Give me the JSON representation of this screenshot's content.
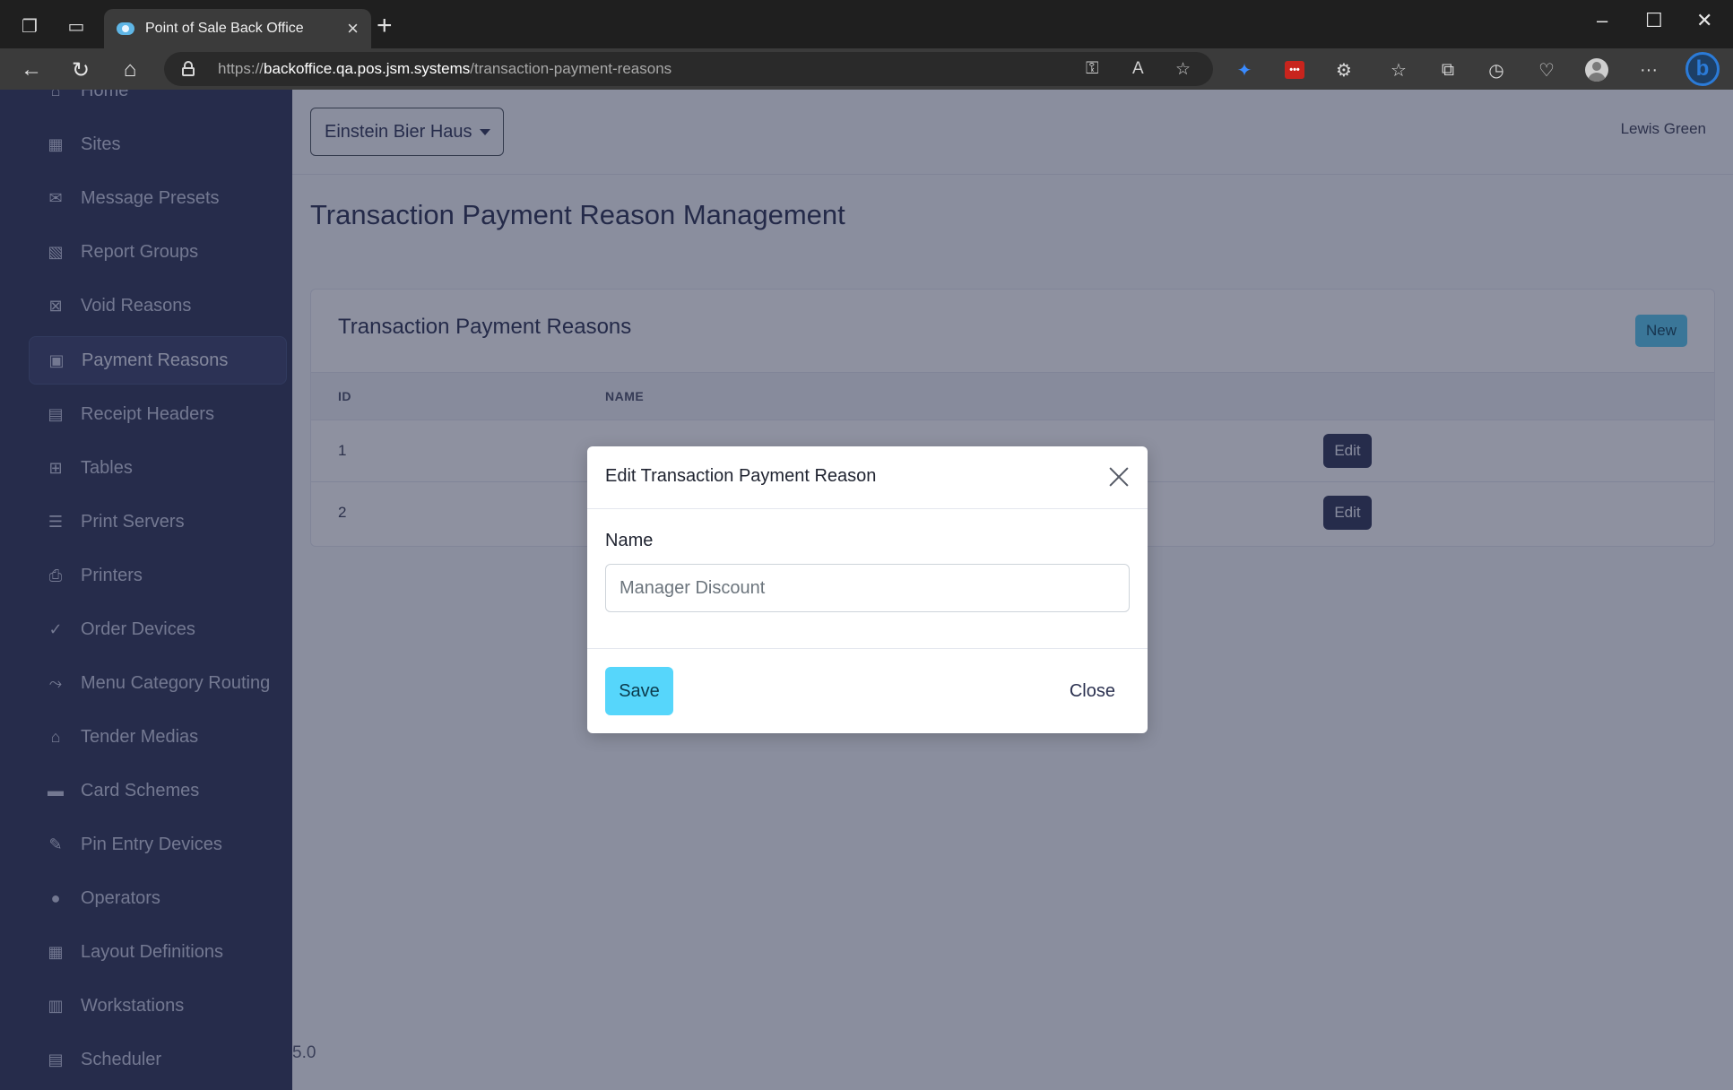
{
  "browser": {
    "tab_title": "Point of Sale Back Office",
    "url_prefix": "https://",
    "url_host": "backoffice.qa.pos.jsm.systems",
    "url_path": "/transaction-payment-reasons",
    "new_tab_glyph": "+",
    "tab_close_glyph": "×",
    "controls": {
      "minimize": "–",
      "maximize": "☐",
      "close": "✕"
    },
    "icons": [
      "workspaces-icon",
      "tab-actions-icon",
      "back-icon",
      "refresh-icon",
      "home-icon",
      "lock-icon",
      "key-icon",
      "read-aloud-icon",
      "favorite-star-icon",
      "pin-extension-icon",
      "lastpass-extension-icon",
      "extensions-icon",
      "favorites-icon",
      "collections-icon",
      "history-icon",
      "performance-icon",
      "profile-icon",
      "more-icon",
      "bing-copilot-icon"
    ]
  },
  "sidebar": {
    "items": [
      {
        "label": "Home",
        "icon": "home-icon",
        "glyph": "⌂"
      },
      {
        "label": "Sites",
        "icon": "building-icon",
        "glyph": "▦"
      },
      {
        "label": "Message Presets",
        "icon": "envelope-icon",
        "glyph": "✉"
      },
      {
        "label": "Report Groups",
        "icon": "report-icon",
        "glyph": "▧"
      },
      {
        "label": "Void Reasons",
        "icon": "x-square-icon",
        "glyph": "⊠"
      },
      {
        "label": "Payment Reasons",
        "icon": "money-icon",
        "glyph": "▣",
        "active": true
      },
      {
        "label": "Receipt Headers",
        "icon": "receipt-icon",
        "glyph": "▤"
      },
      {
        "label": "Tables",
        "icon": "table-icon",
        "glyph": "⊞"
      },
      {
        "label": "Print Servers",
        "icon": "server-icon",
        "glyph": "☰"
      },
      {
        "label": "Printers",
        "icon": "printer-icon",
        "glyph": "⎙"
      },
      {
        "label": "Order Devices",
        "icon": "check-icon",
        "glyph": "✓"
      },
      {
        "label": "Menu Category Routing",
        "icon": "route-icon",
        "glyph": "⤳"
      },
      {
        "label": "Tender Medias",
        "icon": "bank-icon",
        "glyph": "⌂"
      },
      {
        "label": "Card Schemes",
        "icon": "credit-card-icon",
        "glyph": "▬"
      },
      {
        "label": "Pin Entry Devices",
        "icon": "pin-device-icon",
        "glyph": "✎"
      },
      {
        "label": "Operators",
        "icon": "user-icon",
        "glyph": "●"
      },
      {
        "label": "Layout Definitions",
        "icon": "grid-icon",
        "glyph": "▦"
      },
      {
        "label": "Workstations",
        "icon": "cash-register-icon",
        "glyph": "▥"
      },
      {
        "label": "Scheduler",
        "icon": "clipboard-icon",
        "glyph": "▤"
      }
    ]
  },
  "header": {
    "site_selector": "Einstein Bier Haus",
    "user": "Lewis Green"
  },
  "main": {
    "page_title": "Transaction Payment Reason Management",
    "card_title": "Transaction Payment Reasons",
    "new_button": "New",
    "columns": [
      "ID",
      "NAME"
    ],
    "rows": [
      {
        "id": "1",
        "name": "",
        "action": "Edit"
      },
      {
        "id": "2",
        "name": "",
        "action": "Edit"
      }
    ],
    "version": "5.0"
  },
  "modal": {
    "title": "Edit Transaction Payment Reason",
    "field_label": "Name",
    "field_placeholder": "Manager Discount",
    "field_value": "",
    "save_label": "Save",
    "close_label": "Close"
  },
  "colors": {
    "sidebar_bg": "#2e3454",
    "accent_info": "#56d6fb",
    "edit_button": "#2e3454",
    "backdrop": "rgba(30,36,66,0.5)"
  }
}
